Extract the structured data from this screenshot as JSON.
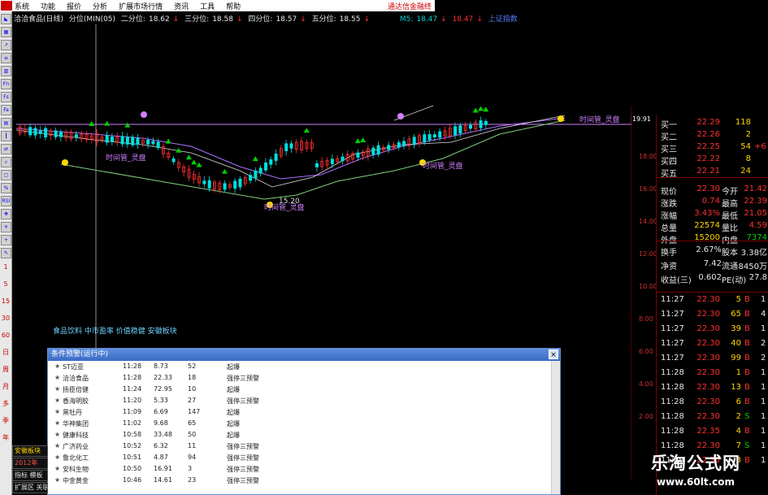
{
  "menubar": {
    "items": [
      "系统",
      "功能",
      "报价",
      "分析",
      "扩展市场行情",
      "资讯",
      "工具",
      "帮助"
    ],
    "right_text": "通达信金融终"
  },
  "toolbar": {
    "icon_labels": [
      "Fn",
      "Fs",
      "Fa",
      "RSI"
    ],
    "period_labels": [
      "1",
      "5",
      "15",
      "30",
      "60",
      "日",
      "周",
      "月",
      "多",
      "季",
      "年"
    ]
  },
  "title": {
    "stock": "洽洽食品(日线)",
    "indicator": "分位(MIN(05)",
    "q2_label": "二分位:",
    "q2": "18.62",
    "q3_label": "三分位:",
    "q3": "18.58",
    "q4_label": "四分位:",
    "q4": "18.57",
    "q5_label": "五分位:",
    "q5": "18.55",
    "m5_label": "M5:",
    "m5": "18.47",
    "m_red": "18.47",
    "m_blue": "上证指数"
  },
  "chart": {
    "price_tag": "19.91",
    "annotations": [
      "时间管_灵盘",
      "时间管_灵盘",
      "时间管_灵盘",
      "时间管_灵盘"
    ],
    "low_label": "15.20",
    "axis_labels": [
      "18.00",
      "16.00",
      "14.00",
      "12.00",
      "10.00",
      "8.00",
      "6.00",
      "4.00",
      "2.00"
    ],
    "sector_text": "食品饮料 中市盈率 价值稳健 安徽板块",
    "colors": {
      "up": "#ff3030",
      "down": "#00e0e0",
      "ma": "#c080ff"
    }
  },
  "quote": {
    "bids": [
      {
        "label": "买一",
        "price": "22.29",
        "vol": "118",
        "extra": ""
      },
      {
        "label": "买二",
        "price": "22.26",
        "vol": "2",
        "extra": ""
      },
      {
        "label": "买三",
        "price": "22.25",
        "vol": "54",
        "extra": "+6"
      },
      {
        "label": "买四",
        "price": "22.22",
        "vol": "8",
        "extra": ""
      },
      {
        "label": "买五",
        "price": "22.21",
        "vol": "24",
        "extra": ""
      }
    ],
    "stats": [
      {
        "l1": "现价",
        "v1": "22.30",
        "l2": "今开",
        "v2": "21.42"
      },
      {
        "l1": "涨跌",
        "v1": "0.74",
        "l2": "最高",
        "v2": "22.39"
      },
      {
        "l1": "涨幅",
        "v1": "3.43%",
        "l2": "最低",
        "v2": "21.05"
      },
      {
        "l1": "总量",
        "v1": "22574",
        "l2": "量比",
        "v2": "4.59"
      },
      {
        "l1": "外盘",
        "v1": "15200",
        "l2": "内盘",
        "v2": "7374"
      }
    ],
    "fund": [
      {
        "l1": "换手",
        "v1": "2.67%",
        "l2": "股本",
        "v2": "3.38亿"
      },
      {
        "l1": "净资",
        "v1": "7.42",
        "l2": "流通",
        "v2": "8450万"
      },
      {
        "l1": "收益(三)",
        "v1": "0.602",
        "l2": "PE(动)",
        "v2": "27.8"
      }
    ],
    "ticks": [
      {
        "t": "11:27",
        "p": "22.30",
        "v": "5",
        "s": "B",
        "x": "1"
      },
      {
        "t": "11:27",
        "p": "22.30",
        "v": "65",
        "s": "B",
        "x": "4"
      },
      {
        "t": "11:27",
        "p": "22.30",
        "v": "39",
        "s": "B",
        "x": "1"
      },
      {
        "t": "11:27",
        "p": "22.30",
        "v": "40",
        "s": "B",
        "x": "2"
      },
      {
        "t": "11:27",
        "p": "22.30",
        "v": "99",
        "s": "B",
        "x": "2"
      },
      {
        "t": "11:28",
        "p": "22.30",
        "v": "1",
        "s": "B",
        "x": "1"
      },
      {
        "t": "11:28",
        "p": "22.30",
        "v": "13",
        "s": "B",
        "x": "1"
      },
      {
        "t": "11:28",
        "p": "22.30",
        "v": "6",
        "s": "B",
        "x": "1"
      },
      {
        "t": "11:28",
        "p": "22.30",
        "v": "2",
        "s": "S",
        "x": "1"
      },
      {
        "t": "11:28",
        "p": "22.35",
        "v": "4",
        "s": "B",
        "x": "1"
      },
      {
        "t": "11:28",
        "p": "22.30",
        "v": "7",
        "s": "S",
        "x": "1"
      },
      {
        "t": "11:29",
        "p": "22.30",
        "v": "3",
        "s": "B",
        "x": "1"
      }
    ]
  },
  "dialog": {
    "title": "条件预警(运行中)",
    "close": "×",
    "alerts": [
      {
        "name": "ST迈亚",
        "time": "11:28",
        "price": "8.73",
        "pct": "52",
        "type": "起爆"
      },
      {
        "name": "洽洽食品",
        "time": "11:28",
        "price": "22.33",
        "pct": "18",
        "type": "强停三预警"
      },
      {
        "name": "扬臣倍健",
        "time": "11:24",
        "price": "72.95",
        "pct": "10",
        "type": "起爆"
      },
      {
        "name": "香海明胶",
        "time": "11:20",
        "price": "5.33",
        "pct": "27",
        "type": "强停三预警"
      },
      {
        "name": "黑牡丹",
        "time": "11:09",
        "price": "6.69",
        "pct": "147",
        "type": "起爆"
      },
      {
        "name": "华神集团",
        "time": "11:02",
        "price": "9.68",
        "pct": "65",
        "type": "起爆"
      },
      {
        "name": "健康科技",
        "time": "10:58",
        "price": "33.48",
        "pct": "50",
        "type": "起爆"
      },
      {
        "name": "广济药业",
        "time": "10:52",
        "price": "6.32",
        "pct": "11",
        "type": "强停三预警"
      },
      {
        "name": "鲁北化工",
        "time": "10:51",
        "price": "4.87",
        "pct": "94",
        "type": "强停三预警"
      },
      {
        "name": "安科生物",
        "time": "10:50",
        "price": "16.91",
        "pct": "3",
        "type": "强停三预警"
      },
      {
        "name": "中金黄金",
        "time": "10:46",
        "price": "14.61",
        "pct": "23",
        "type": "强停三预警"
      }
    ]
  },
  "tabs": [
    "安徽板块",
    "2012年",
    "指标  模板",
    "扩展区  关联"
  ],
  "watermark": {
    "title": "乐淘公式网",
    "url": "www.60lt.com"
  }
}
